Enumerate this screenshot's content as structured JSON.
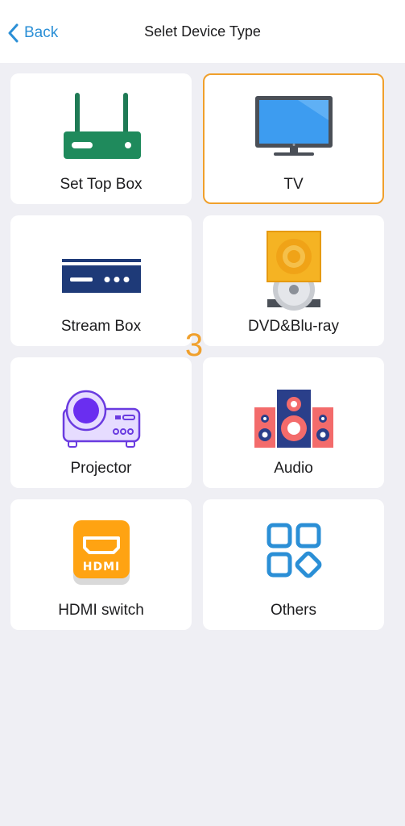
{
  "nav": {
    "back_label": "Back",
    "title": "Selet Device Type"
  },
  "devices": [
    {
      "label": "Set Top Box",
      "icon": "set-top-box-icon",
      "selected": false
    },
    {
      "label": "TV",
      "icon": "tv-icon",
      "selected": true
    },
    {
      "label": "Stream Box",
      "icon": "stream-box-icon",
      "selected": false
    },
    {
      "label": "DVD&Blu-ray",
      "icon": "dvd-icon",
      "selected": false
    },
    {
      "label": "Projector",
      "icon": "projector-icon",
      "selected": false
    },
    {
      "label": "Audio",
      "icon": "speaker-icon",
      "selected": false
    },
    {
      "label": "HDMI switch",
      "icon": "hdmi-icon",
      "selected": false
    },
    {
      "label": "Others",
      "icon": "apps-icon",
      "selected": false
    }
  ],
  "badge": "3",
  "colors": {
    "accent": "#2b8fd6",
    "selected_border": "#f0a02c",
    "background": "#efeff4"
  }
}
